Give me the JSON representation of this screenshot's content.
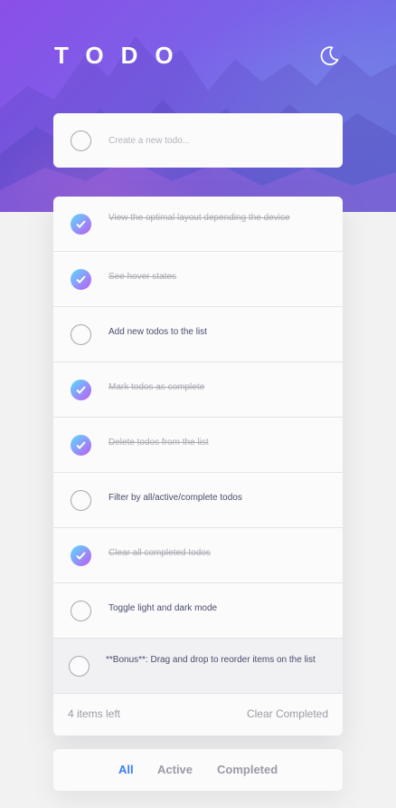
{
  "header": {
    "title": "TODO",
    "theme_icon": "moon-icon"
  },
  "new_todo": {
    "placeholder": "Create a new todo..."
  },
  "todos": [
    {
      "text": "View the optimal layout depending the device",
      "completed": true
    },
    {
      "text": "See hover states",
      "completed": true
    },
    {
      "text": "Add new todos to the list",
      "completed": false
    },
    {
      "text": "Mark todos as complete",
      "completed": true
    },
    {
      "text": "Delete todos from the list",
      "completed": true
    },
    {
      "text": "Filter by all/active/complete todos",
      "completed": false
    },
    {
      "text": "Clear all completed todos",
      "completed": true
    },
    {
      "text": "Toggle light and dark mode",
      "completed": false
    },
    {
      "text": "**Bonus**: Drag and drop to reorder items on the list",
      "completed": false
    }
  ],
  "footer": {
    "items_left": "4 items left",
    "clear_label": "Clear Completed"
  },
  "filters": {
    "all": "All",
    "active": "Active",
    "completed": "Completed",
    "selected": "all"
  },
  "colors": {
    "accent": "#3a7bfd",
    "check_gradient_start": "#57ddff",
    "check_gradient_end": "#c058f3",
    "hero_start": "#8a4fe8",
    "hero_end": "#6a7fe6"
  }
}
